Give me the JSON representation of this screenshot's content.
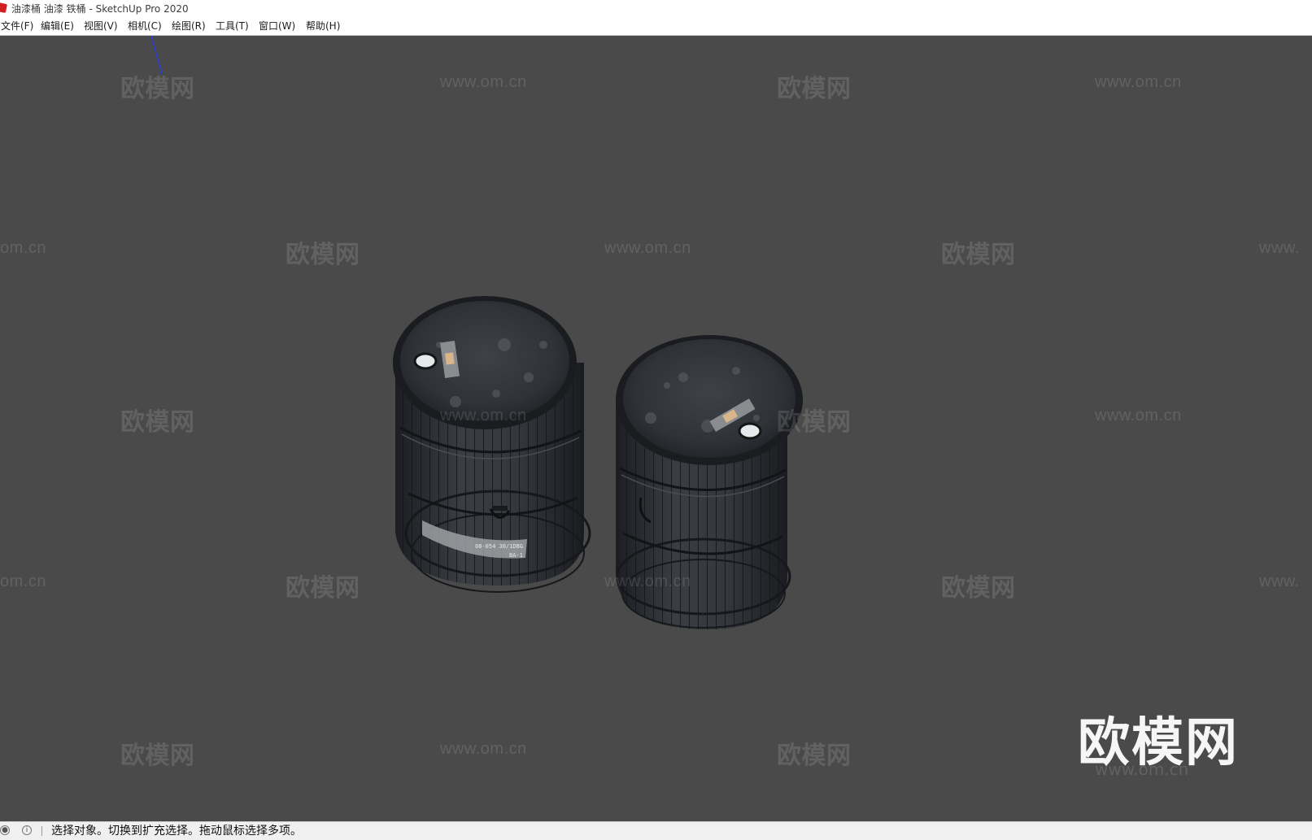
{
  "window": {
    "title": "油漆桶 油漆 铁桶 - SketchUp Pro 2020"
  },
  "menu": [
    {
      "label": "文件(F)"
    },
    {
      "label": "编辑(E)"
    },
    {
      "label": "视图(V)"
    },
    {
      "label": "相机(C)"
    },
    {
      "label": "绘图(R)"
    },
    {
      "label": "工具(T)"
    },
    {
      "label": "窗口(W)"
    },
    {
      "label": "帮助(H)"
    }
  ],
  "watermarks": {
    "cn": "欧模网",
    "url": "www.om.cn",
    "url_partial_left": "om.cn",
    "url_partial_right": "www."
  },
  "logo": {
    "text": "欧模网",
    "url": "www.om.cn"
  },
  "barrels": {
    "left_label_line1": "08-054 30/1DBG",
    "left_label_line2": "BA-1"
  },
  "status": {
    "text": "选择对象。切换到扩充选择。拖动鼠标选择多项。"
  },
  "colors": {
    "viewport_bg": "#4a4a4a",
    "barrel_dark": "#2b2e33",
    "axis_blue": "#2a3bd6",
    "app_icon_red": "#d21f1f"
  }
}
